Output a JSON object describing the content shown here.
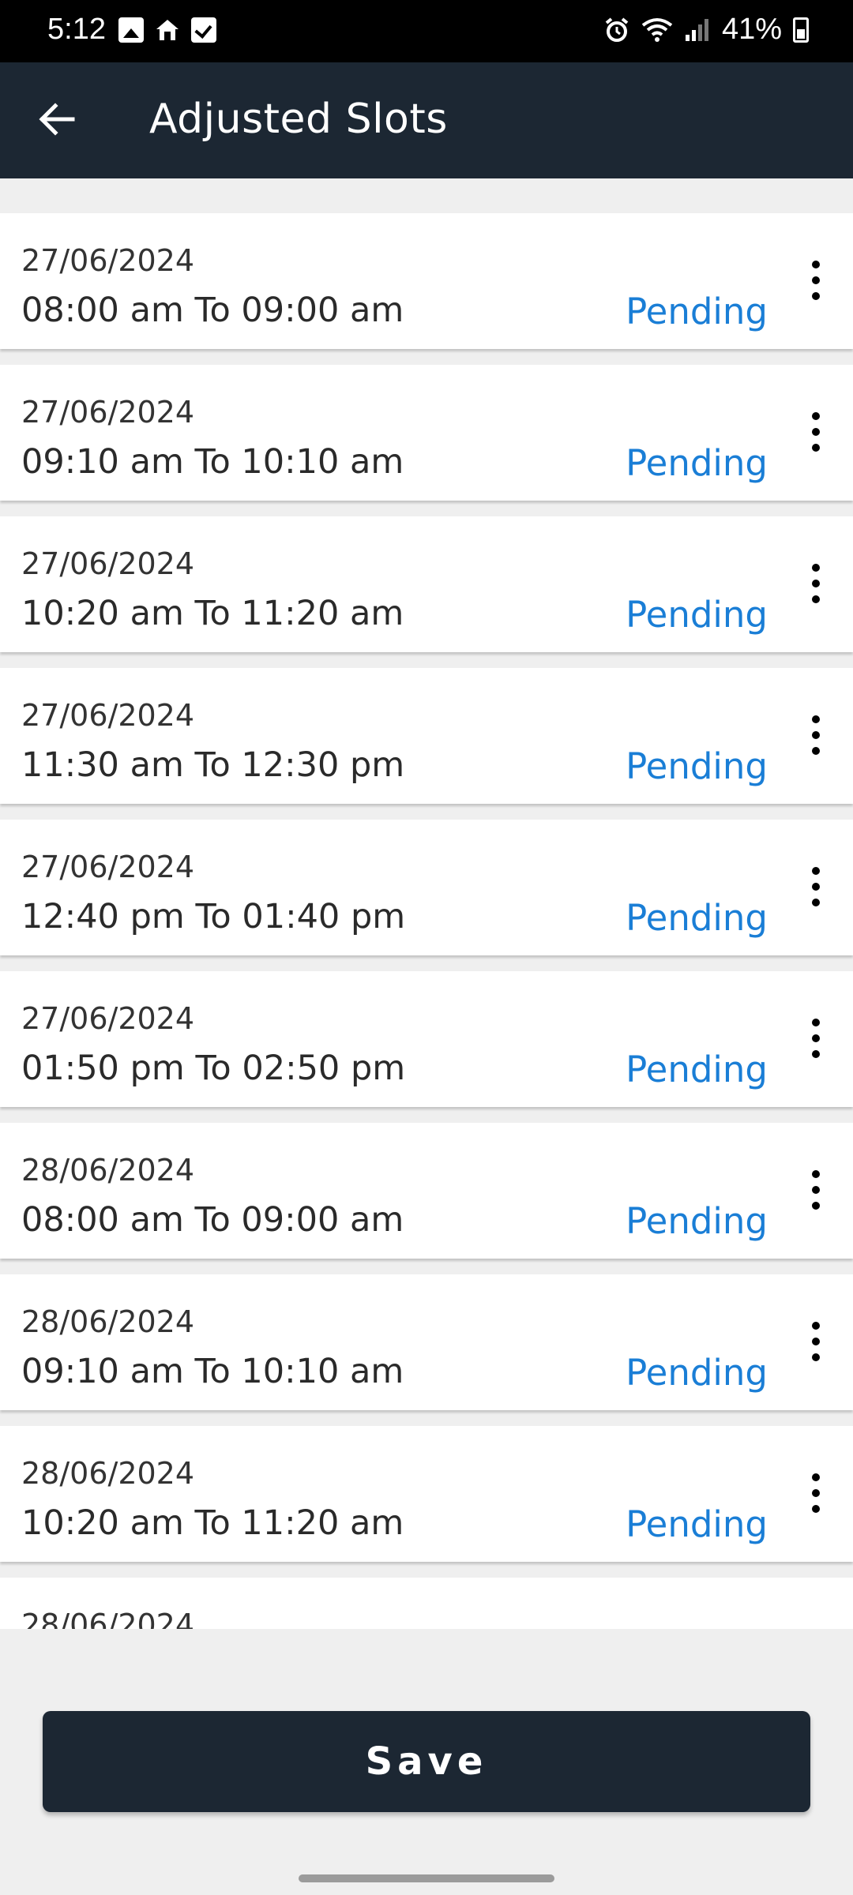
{
  "status_bar": {
    "time": "5:12",
    "battery": "41%",
    "left_icons": [
      "gallery-icon",
      "home-icon",
      "checkbox-icon"
    ],
    "right_icons": [
      "alarm-icon",
      "wifi-icon",
      "signal-icon",
      "battery-icon"
    ]
  },
  "header": {
    "title": "Adjusted Slots",
    "back_icon": "arrow-left-icon",
    "background": "#1c2733"
  },
  "slots": [
    {
      "date": "27/06/2024",
      "time": "08:00 am To 09:00 am",
      "status": "Pending"
    },
    {
      "date": "27/06/2024",
      "time": "09:10 am To 10:10 am",
      "status": "Pending"
    },
    {
      "date": "27/06/2024",
      "time": "10:20 am To 11:20 am",
      "status": "Pending"
    },
    {
      "date": "27/06/2024",
      "time": "11:30 am To 12:30 pm",
      "status": "Pending"
    },
    {
      "date": "27/06/2024",
      "time": "12:40 pm To 01:40 pm",
      "status": "Pending"
    },
    {
      "date": "27/06/2024",
      "time": "01:50 pm To 02:50 pm",
      "status": "Pending"
    },
    {
      "date": "28/06/2024",
      "time": "08:00 am To 09:00 am",
      "status": "Pending"
    },
    {
      "date": "28/06/2024",
      "time": "09:10 am To 10:10 am",
      "status": "Pending"
    },
    {
      "date": "28/06/2024",
      "time": "10:20 am To 11:20 am",
      "status": "Pending"
    },
    {
      "date": "28/06/2024",
      "time": "",
      "status": ""
    }
  ],
  "status_color": "#1a7ed6",
  "footer": {
    "save_label": "Save"
  }
}
